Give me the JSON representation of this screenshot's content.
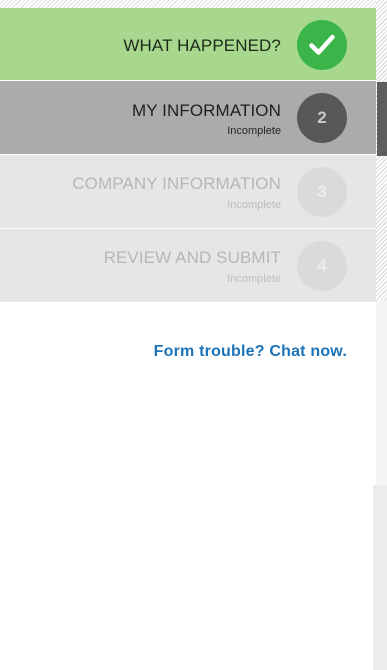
{
  "steps": [
    {
      "label": "WHAT HAPPENED?",
      "status": "",
      "badge": "",
      "state": "complete"
    },
    {
      "label": "MY INFORMATION",
      "status": "Incomplete",
      "badge": "2",
      "state": "active"
    },
    {
      "label": "COMPANY INFORMATION",
      "status": "Incomplete",
      "badge": "3",
      "state": "pending"
    },
    {
      "label": "REVIEW AND SUBMIT",
      "status": "Incomplete",
      "badge": "4",
      "state": "pending"
    }
  ],
  "help": {
    "chat_link": "Form trouble? Chat now."
  },
  "colors": {
    "complete_bg": "#a8d88e",
    "complete_badge": "#3bb54a",
    "active_bg": "#ababab",
    "active_badge": "#585858",
    "pending_bg": "#e6e6e6",
    "link": "#1d73b8"
  },
  "icons": {
    "complete_badge": "checkmark-icon"
  }
}
